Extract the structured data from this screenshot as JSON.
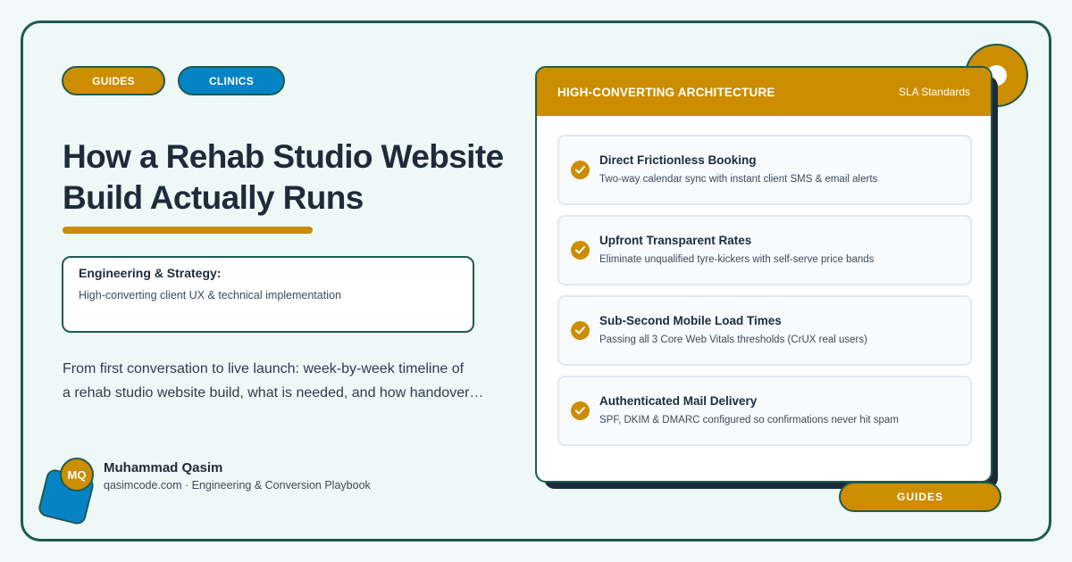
{
  "tags": {
    "primary": "GUIDES",
    "secondary": "CLINICS",
    "bottom": "GUIDES"
  },
  "headline": {
    "line1": "How a Rehab Studio Website",
    "line2": "Build Actually Runs"
  },
  "strategy": {
    "title": "Engineering & Strategy:",
    "subtitle": "High-converting client UX & technical implementation"
  },
  "description": {
    "line1": "From first conversation to live launch: week-by-week timeline of",
    "line2": "a rehab studio website build, what is needed, and how handover…"
  },
  "author": {
    "initials": "MQ",
    "name": "Muhammad Qasim",
    "meta": "qasimcode.com · Engineering & Conversion Playbook"
  },
  "card": {
    "title": "HIGH-CONVERTING ARCHITECTURE",
    "tag": "SLA Standards",
    "items": [
      {
        "title": "Direct Frictionless Booking",
        "desc": "Two-way calendar sync with instant client SMS & email alerts"
      },
      {
        "title": "Upfront Transparent Rates",
        "desc": "Eliminate unqualified tyre-kickers with self-serve price bands"
      },
      {
        "title": "Sub-Second Mobile Load Times",
        "desc": "Passing all 3 Core Web Vitals thresholds (CrUX real users)"
      },
      {
        "title": "Authenticated Mail Delivery",
        "desc": "SPF, DKIM & DMARC configured so confirmations never hit spam"
      }
    ]
  },
  "colors": {
    "accent_gold": "#cc8d00",
    "accent_blue": "#0584c5",
    "border_green": "#1f5a50",
    "text_dark": "#1e2b3a",
    "background": "#eef8f7"
  },
  "icons": {
    "check": "check-circle-icon"
  }
}
